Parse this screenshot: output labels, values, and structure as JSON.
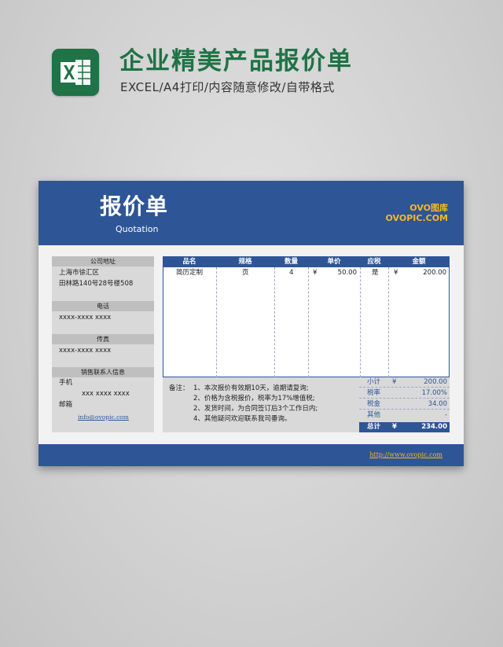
{
  "promo": {
    "title": "企业精美产品报价单",
    "subtitle": "EXCEL/A4打印/内容随意修改/自带格式"
  },
  "header": {
    "title": "报价单",
    "subtitle": "Quotation",
    "brand_line1": "OVO图库",
    "brand_line2": "OVOPIC.COM"
  },
  "info": {
    "address_label": "公司地址",
    "address_line1": "上海市徐汇区",
    "address_line2": "田林路140号28号楼508",
    "phone_label": "电话",
    "phone_value": "xxxx-xxxx xxxx",
    "fax_label": "传真",
    "fax_value": "xxxx-xxxx xxxx",
    "sales_label": "销售联系人信息",
    "mobile_label": "手机",
    "mobile_value": "xxx  xxxx xxxx",
    "email_label": "邮箱",
    "email_value": "info@ovopic.com"
  },
  "table": {
    "headers": [
      "品名",
      "规格",
      "数量",
      "单价",
      "应税",
      "金额"
    ],
    "rows": [
      {
        "name": "简历定制",
        "spec": "页",
        "qty": "4",
        "price_cur": "¥",
        "price": "50.00",
        "taxable": "是",
        "amount_cur": "¥",
        "amount": "200.00"
      }
    ]
  },
  "notes": {
    "label": "备注：",
    "lines": [
      "1、本次报价有效期10天，逾期请复询;",
      "2、价格为含税报价，税率为17%增值税;",
      "2、发货时间，为合同签订后3个工作日内;",
      "4、其他疑问欢迎联系我司垂询。"
    ]
  },
  "totals": {
    "subtotal_label": "小计",
    "subtotal_cur": "¥",
    "subtotal": "200.00",
    "rate_label": "税率",
    "rate": "17.00%",
    "tax_label": "税金",
    "tax": "34.00",
    "other_label": "其他",
    "other": "-",
    "total_label": "总计",
    "total_cur": "¥",
    "total": "234.00"
  },
  "footer": {
    "link": "http://www.ovopic.com"
  },
  "colors": {
    "brand_green": "#1f7346",
    "header_blue": "#2e5596",
    "accent_yellow": "#f5b91e"
  },
  "icons": {
    "app_logo": "excel-icon"
  }
}
